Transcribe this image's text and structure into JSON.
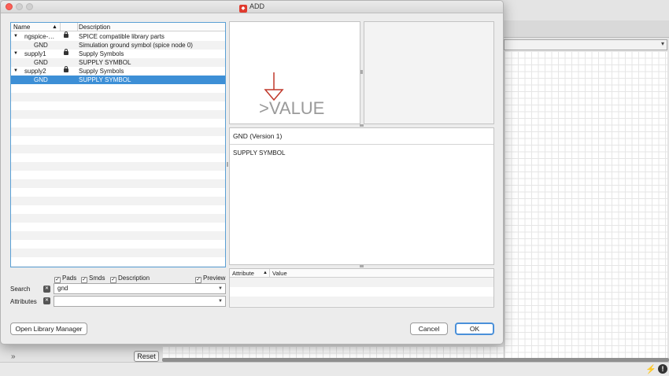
{
  "window": {
    "title": "ADD",
    "title_icon": "eagle-add-icon"
  },
  "tree": {
    "columns": {
      "name": "Name",
      "sort": "▲",
      "description": "Description"
    },
    "rows": [
      {
        "expander": "▼",
        "name": "ngspice-…",
        "locked": true,
        "description": "SPICE compatible library parts",
        "level": 0,
        "selected": false
      },
      {
        "expander": "",
        "name": "GND",
        "locked": false,
        "description": "Simulation ground symbol (spice node 0)",
        "level": 1,
        "selected": false
      },
      {
        "expander": "▼",
        "name": "supply1",
        "locked": true,
        "description": "Supply Symbols",
        "level": 0,
        "selected": false
      },
      {
        "expander": "",
        "name": "GND",
        "locked": false,
        "description": "SUPPLY SYMBOL",
        "level": 1,
        "selected": false
      },
      {
        "expander": "▼",
        "name": "supply2",
        "locked": true,
        "description": "Supply Symbols",
        "level": 0,
        "selected": false
      },
      {
        "expander": "",
        "name": "GND",
        "locked": false,
        "description": "SUPPLY SYMBOL",
        "level": 1,
        "selected": true
      }
    ],
    "empty_rows": 22
  },
  "filters": {
    "pads": {
      "label": "Pads",
      "checked": true
    },
    "smds": {
      "label": "Smds",
      "checked": true
    },
    "description": {
      "label": "Description",
      "checked": true
    },
    "preview": {
      "label": "Preview",
      "checked": true
    }
  },
  "search": {
    "label": "Search",
    "value": "gnd"
  },
  "attributes": {
    "label": "Attributes",
    "value": ""
  },
  "symbol_preview": {
    "value_text": ">VALUE",
    "symbol_color": "#c0392b"
  },
  "details": {
    "title": "GND (Version 1)",
    "text": "SUPPLY SYMBOL"
  },
  "attr_table": {
    "col_attribute": "Attribute",
    "sort": "▲",
    "col_value": "Value"
  },
  "buttons": {
    "library_manager": "Open Library Manager",
    "cancel": "Cancel",
    "ok": "OK"
  },
  "background": {
    "reset": "Reset",
    "collapse_icon": "»"
  },
  "colors": {
    "selection": "#3d8fd6",
    "focus": "#4a90d9",
    "close": "#fc5f57"
  }
}
